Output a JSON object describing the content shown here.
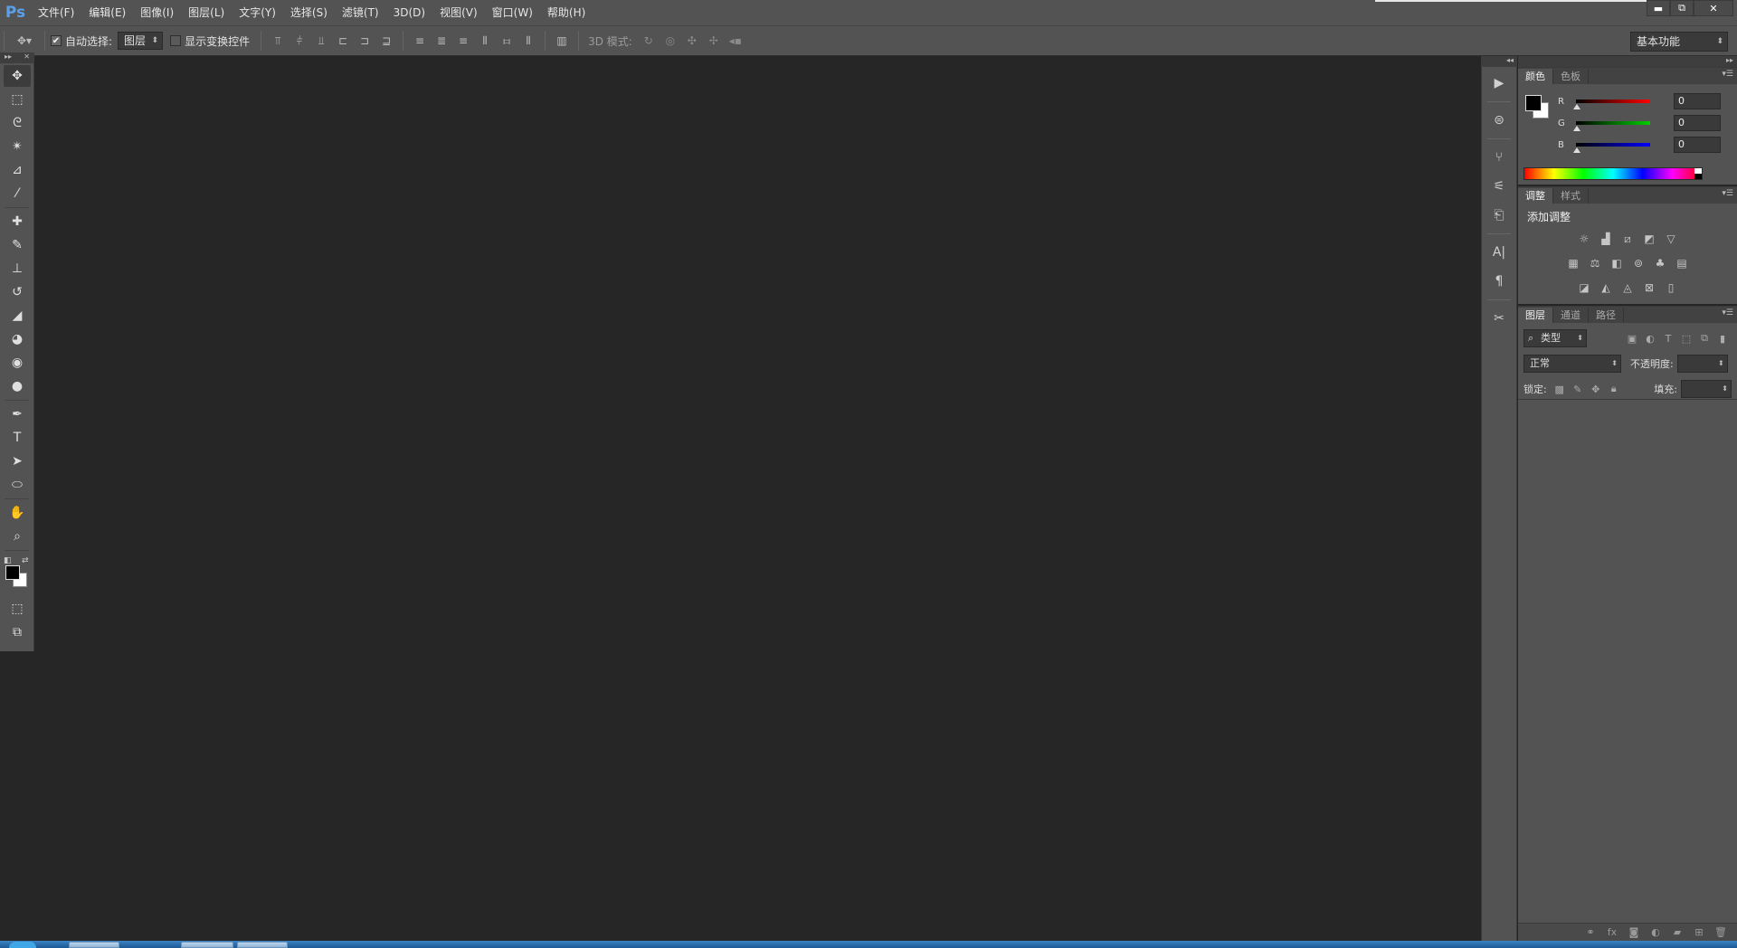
{
  "app": {
    "logo": "Ps",
    "menus": [
      "文件(F)",
      "编辑(E)",
      "图像(I)",
      "图层(L)",
      "文字(Y)",
      "选择(S)",
      "滤镜(T)",
      "3D(D)",
      "视图(V)",
      "窗口(W)",
      "帮助(H)"
    ]
  },
  "window_controls": {
    "minimize": "▬",
    "restore": "⧉",
    "close": "✕"
  },
  "options_bar": {
    "auto_select_label": "自动选择:",
    "auto_select_checked": true,
    "auto_select_target": "图层",
    "show_transform_label": "显示变换控件",
    "show_transform_checked": false,
    "mode3d_label": "3D 模式:",
    "workspace": "基本功能"
  },
  "tools": [
    {
      "name": "move-tool",
      "glyph": "✥"
    },
    {
      "name": "rect-marquee-tool",
      "glyph": "⬚"
    },
    {
      "name": "lasso-tool",
      "glyph": "ᘓ"
    },
    {
      "name": "magic-wand-tool",
      "glyph": "✴"
    },
    {
      "name": "crop-tool",
      "glyph": "⊿"
    },
    {
      "name": "eyedropper-tool",
      "glyph": "⁄"
    },
    {
      "name": "healing-brush-tool",
      "glyph": "✚"
    },
    {
      "name": "brush-tool",
      "glyph": "✎"
    },
    {
      "name": "clone-stamp-tool",
      "glyph": "⊥"
    },
    {
      "name": "history-brush-tool",
      "glyph": "↺"
    },
    {
      "name": "eraser-tool",
      "glyph": "◢"
    },
    {
      "name": "paint-bucket-tool",
      "glyph": "◕"
    },
    {
      "name": "blur-tool",
      "glyph": "◉"
    },
    {
      "name": "dodge-tool",
      "glyph": "●"
    },
    {
      "name": "pen-tool",
      "glyph": "✒"
    },
    {
      "name": "type-tool",
      "glyph": "T"
    },
    {
      "name": "path-selection-tool",
      "glyph": "➤"
    },
    {
      "name": "ellipse-tool",
      "glyph": "⬭"
    },
    {
      "name": "hand-tool",
      "glyph": "✋"
    },
    {
      "name": "zoom-tool",
      "glyph": "⌕"
    }
  ],
  "dock_icons": [
    "play-icon",
    "record-icon",
    "brush-presets-icon",
    "tool-presets-icon",
    "clone-source-icon",
    "character-icon",
    "paragraph-icon",
    "tools-icon"
  ],
  "color_panel": {
    "tabs": [
      "颜色",
      "色板"
    ],
    "channels": [
      {
        "label": "R",
        "value": "0",
        "color": "#ff0000"
      },
      {
        "label": "G",
        "value": "0",
        "color": "#00d000"
      },
      {
        "label": "B",
        "value": "0",
        "color": "#0000ff"
      }
    ]
  },
  "adjust_panel": {
    "tabs": [
      "调整",
      "样式"
    ],
    "title": "添加调整"
  },
  "layers_panel": {
    "tabs": [
      "图层",
      "通道",
      "路径"
    ],
    "filter_kind": "类型",
    "blend_mode": "正常",
    "opacity_label": "不透明度:",
    "lock_label": "锁定:",
    "fill_label": "填充:"
  }
}
